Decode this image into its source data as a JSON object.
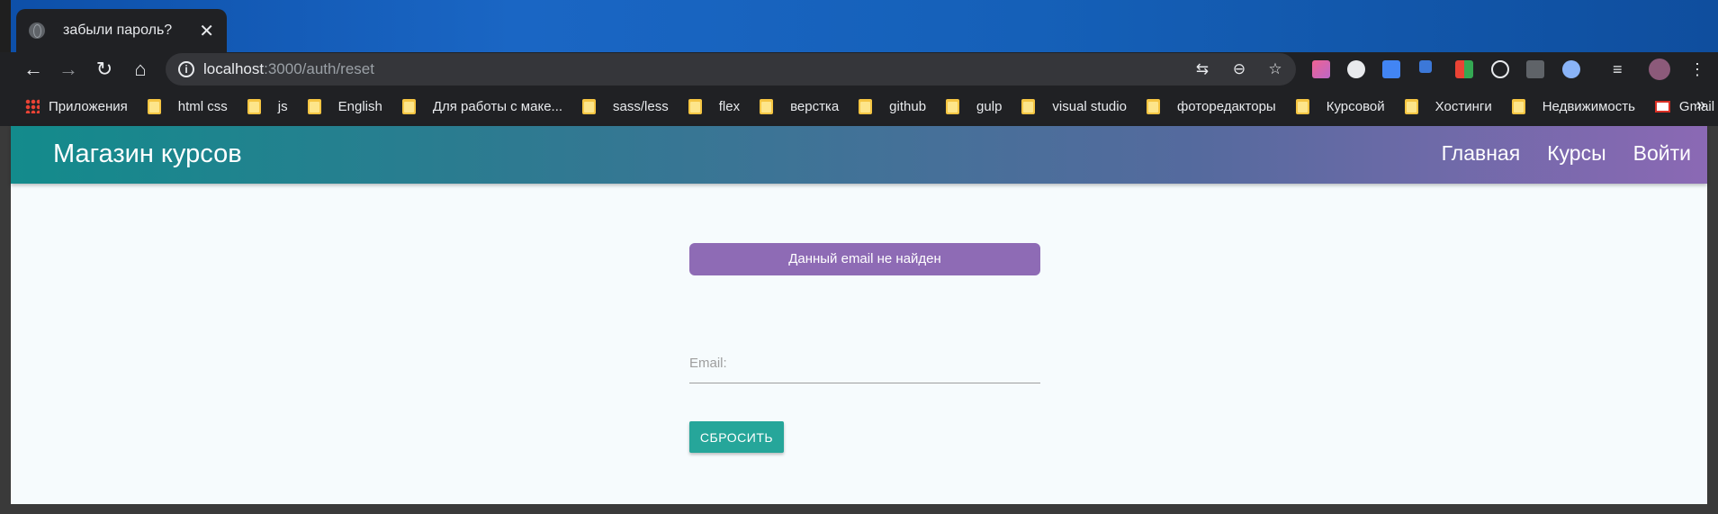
{
  "browser": {
    "tab_title": "забыли пароль?",
    "tab_close": "✕",
    "url_host": "localhost",
    "url_path": ":3000/auth/reset"
  },
  "bookmarks": {
    "apps_label": "Приложения",
    "items": [
      "html css",
      "js",
      "English",
      "Для работы с маке...",
      "sass/less",
      "flex",
      "верстка",
      "github",
      "gulp",
      "visual studio",
      "фоторедакторы",
      "Курсовой",
      "Хостинги",
      "Недвижимость"
    ],
    "gmail_label": "Gmail",
    "more": "»"
  },
  "site": {
    "brand": "Магазин курсов",
    "nav": [
      "Главная",
      "Курсы",
      "Войти"
    ]
  },
  "reset_form": {
    "alert_text": "Данный email не найден",
    "email_label": "Email:",
    "email_value": "",
    "submit_label": "СБРОСИТЬ"
  },
  "colors": {
    "navbar_gradient_start": "#138b8c",
    "navbar_gradient_end": "#8b69b4",
    "alert_bg": "#8e6bb5",
    "button_bg": "#26a69a",
    "page_bg": "#f6fbfd"
  }
}
